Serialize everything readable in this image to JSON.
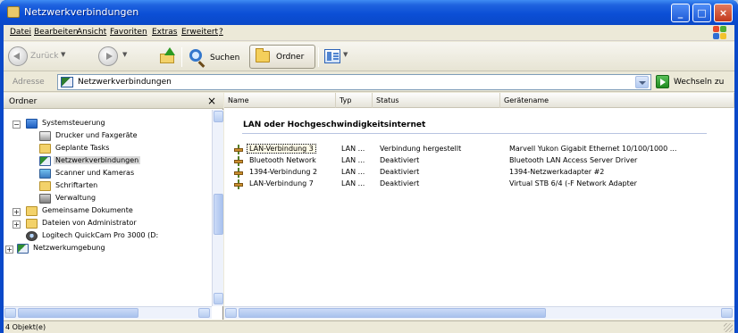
{
  "window": {
    "title": "Netzwerkverbindungen",
    "controls": [
      "_",
      "□",
      "×"
    ]
  },
  "menu": [
    "Datei",
    "Bearbeiten",
    "Ansicht",
    "Favoriten",
    "Extras",
    "Erweitert",
    "?"
  ],
  "toolbar": {
    "back_label": "Zurück",
    "search_label": "Suchen",
    "folder_label": "Ordner"
  },
  "address": {
    "label": "Adresse",
    "value": "Netzwerkverbindungen",
    "go_label": "Wechseln zu"
  },
  "folders_panel": {
    "title": "Ordner",
    "close": "×",
    "items": [
      {
        "label": "Systemsteuerung",
        "icon": "control-panel-icon",
        "expanded": true
      },
      {
        "label": "Drucker und Faxgeräte",
        "icon": "printer-icon"
      },
      {
        "label": "Geplante Tasks",
        "icon": "folder-icon"
      },
      {
        "label": "Netzwerkverbindungen",
        "icon": "network-icon",
        "selected": true
      },
      {
        "label": "Scanner und Kameras",
        "icon": "scanner-icon"
      },
      {
        "label": "Schriftarten",
        "icon": "folder-icon"
      },
      {
        "label": "Verwaltung",
        "icon": "tools-icon"
      },
      {
        "label": "Gemeinsame Dokumente",
        "icon": "folder-icon",
        "collapsed": true
      },
      {
        "label": "Dateien von Administrator",
        "icon": "folder-icon",
        "collapsed": true
      },
      {
        "label": "Logitech QuickCam Pro 3000 (D:",
        "icon": "camera-icon"
      },
      {
        "label": "Netzwerkumgebung",
        "icon": "network-icon",
        "collapsed": true
      }
    ]
  },
  "list": {
    "columns": [
      "Name",
      "Typ",
      "Status",
      "Gerätename"
    ],
    "group": "LAN oder Hochgeschwindigkeitsinternet",
    "rows": [
      {
        "name": "LAN-Verbindung 3",
        "type": "LAN ...",
        "status": "Verbindung hergestellt",
        "device": "Marvell Yukon Gigabit Ethernet 10/100/1000 ..."
      },
      {
        "name": "Bluetooth Network",
        "type": "LAN ...",
        "status": "Deaktiviert",
        "device": "Bluetooth LAN Access Server Driver"
      },
      {
        "name": "1394-Verbindung 2",
        "type": "LAN ...",
        "status": "Deaktiviert",
        "device": "1394-Netzwerkadapter #2"
      },
      {
        "name": "LAN-Verbindung 7",
        "type": "LAN ...",
        "status": "Deaktiviert",
        "device": "Virtual STB 6/4 (-F Network Adapter"
      }
    ]
  },
  "statusbar": {
    "text": "4 Objekt(e)"
  },
  "colors": {
    "titlebar": "#0a49c9",
    "selection": "#d9d9d9"
  }
}
